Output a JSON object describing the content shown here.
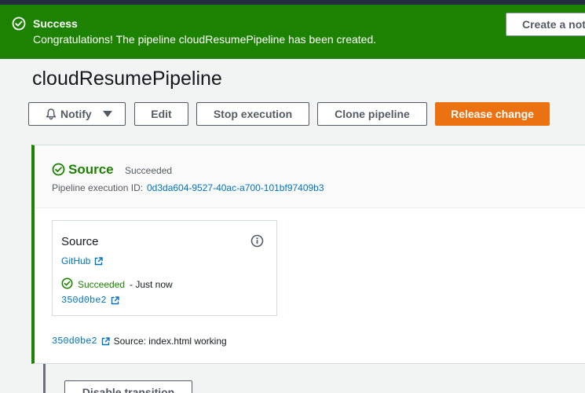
{
  "flash": {
    "title": "Success",
    "message": "Congratulations! The pipeline cloudResumePipeline has been created.",
    "button_label": "Create a notification rule"
  },
  "pipeline": {
    "name": "cloudResumePipeline"
  },
  "toolbar": {
    "notify_label": "Notify",
    "edit_label": "Edit",
    "stop_label": "Stop execution",
    "clone_label": "Clone pipeline",
    "release_label": "Release change"
  },
  "stage": {
    "name": "Source",
    "status": "Succeeded",
    "execution_label": "Pipeline execution ID:",
    "execution_id": "0d3da604-9527-40ac-a700-101bf97409b3",
    "action": {
      "title": "Source",
      "provider": "GitHub",
      "status": "Succeeded",
      "time": "- Just now",
      "commit": "350d0be2"
    },
    "footer": {
      "commit": "350d0be2",
      "source": "Source: index.html working"
    }
  },
  "transition": {
    "button_label": "Disable transition"
  },
  "colors": {
    "success": "#1d8102",
    "primary": "#ec7211",
    "link": "#0073bb",
    "topbar": "#232f3e"
  }
}
